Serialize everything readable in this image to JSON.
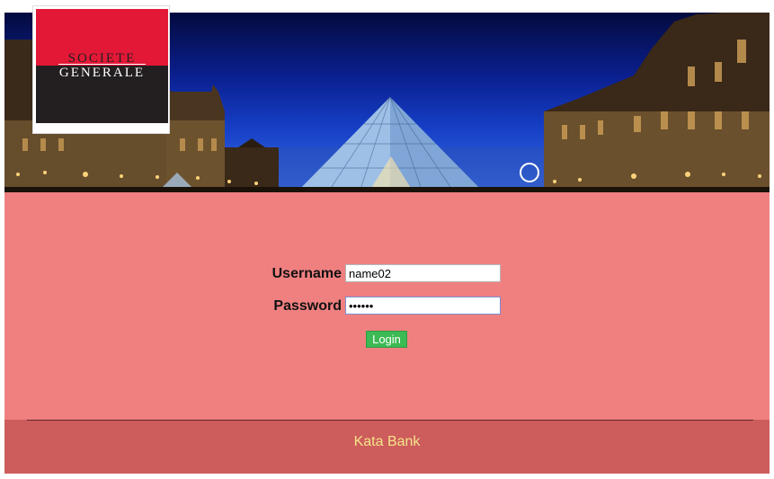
{
  "logo": {
    "line1": "SOCIETE",
    "line2": "GENERALE",
    "brand_colors": {
      "red": "#e31837",
      "black": "#231f20"
    }
  },
  "banner": {
    "subject": "louvre-pyramid-night-photo"
  },
  "form": {
    "username_label": "Username",
    "username_value": "name02",
    "password_label": "Password",
    "password_value": "123456",
    "login_label": "Login"
  },
  "footer": {
    "text": "Kata Bank"
  },
  "colors": {
    "main_bg": "#f08080",
    "footer_bg": "#cd5c5c",
    "footer_text": "#f5e58a",
    "button_bg": "#3cba54"
  }
}
